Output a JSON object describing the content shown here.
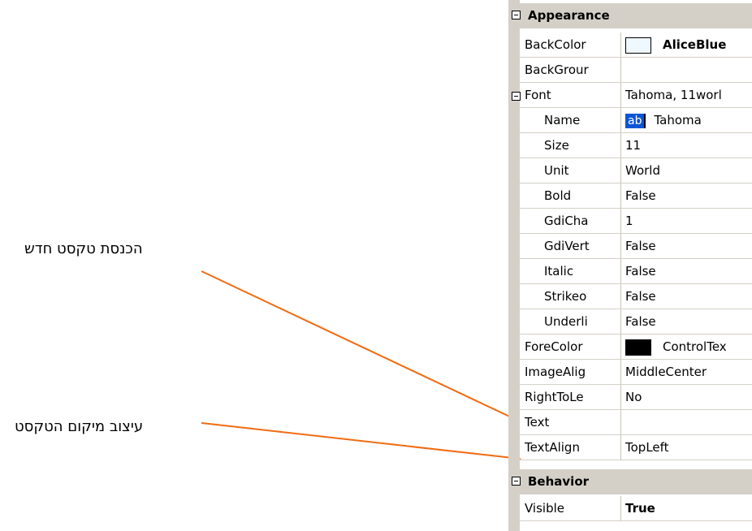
{
  "annotations": {
    "new_text": "הכנסת טקסט חדש",
    "text_position": "עיצוב מיקום הטקסט",
    "arrow_color": "#f26a10"
  },
  "property_grid": {
    "categories": {
      "appearance": "Appearance",
      "behavior": "Behavior"
    },
    "rows": {
      "backcolor": {
        "label": "BackColor",
        "value": "AliceBlue",
        "swatch": "#f0f8ff"
      },
      "backgroundimage": {
        "label": "BackGrour",
        "value": ""
      },
      "font": {
        "label": "Font",
        "value": "Tahoma, 11worl"
      },
      "name": {
        "label": "Name",
        "icon": "ab",
        "value": "Tahoma"
      },
      "size": {
        "label": "Size",
        "value": "11"
      },
      "unit": {
        "label": "Unit",
        "value": "World"
      },
      "bold": {
        "label": "Bold",
        "value": "False"
      },
      "gdicharset": {
        "label": "GdiCha",
        "value": "1"
      },
      "gdivertical": {
        "label": "GdiVert",
        "value": "False"
      },
      "italic": {
        "label": "Italic",
        "value": "False"
      },
      "strikeout": {
        "label": "Strikeo",
        "value": "False"
      },
      "underline": {
        "label": "Underli",
        "value": "False"
      },
      "forecolor": {
        "label": "ForeColor",
        "value": "ControlTex",
        "swatch": "#000000"
      },
      "imagealign": {
        "label": "ImageAlig",
        "value": "MiddleCenter"
      },
      "righttoleft": {
        "label": "RightToLe",
        "value": "No"
      },
      "text": {
        "label": "Text",
        "value": ""
      },
      "textalign": {
        "label": "TextAlign",
        "value": "TopLeft"
      },
      "visible": {
        "label": "Visible",
        "value": "True"
      }
    }
  }
}
